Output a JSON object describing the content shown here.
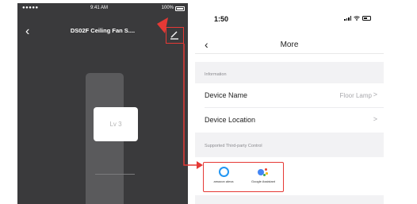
{
  "left_screen": {
    "status_bar": {
      "carrier": "●●●●● ",
      "time": "9:41 AM",
      "battery": "100%"
    },
    "nav": {
      "back_icon": "chevron-left-icon",
      "title": "DS02F Ceiling Fan S....",
      "edit_icon": "pencil-icon"
    },
    "slider": {
      "label": "Lv 3"
    }
  },
  "right_screen": {
    "status_bar": {
      "time": "1:50"
    },
    "nav": {
      "back_icon": "chevron-left-icon",
      "title": "More"
    },
    "information_header": "Information",
    "device_name": {
      "label": "Device Name",
      "value": "Floor Lamp",
      "chevron": ">"
    },
    "device_location": {
      "label": "Device Location",
      "chevron": ">"
    },
    "third_party_header": "Supported Third-party Control",
    "third_party": [
      {
        "name": "amazon alexa",
        "icon": "alexa-icon"
      },
      {
        "name": "Google Assistant",
        "icon": "google-assistant-icon"
      }
    ]
  },
  "colors": {
    "annotation_red": "#e53935",
    "dark_bg": "#3a3a3c",
    "alexa_blue": "#2196f3"
  }
}
